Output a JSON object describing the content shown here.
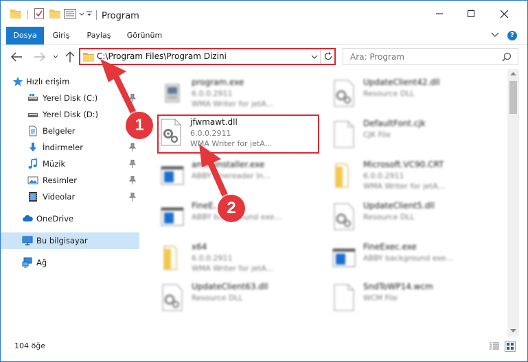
{
  "window": {
    "title": "Program"
  },
  "ribbon": {
    "tabs": [
      "Dosya",
      "Giriş",
      "Paylaş",
      "Görünüm"
    ],
    "help": "?"
  },
  "address": {
    "path": "C:\\Program Files\\Program Dizini"
  },
  "search": {
    "placeholder": "Ara: Program"
  },
  "sidebar": {
    "items": [
      {
        "label": "Hızlı erişim",
        "icon": "star-icon",
        "pinned": false
      },
      {
        "label": "Yerel Disk (C:)",
        "icon": "drive-icon",
        "pinned": true
      },
      {
        "label": "Yerel Disk (D:)",
        "icon": "drive-icon",
        "pinned": true
      },
      {
        "label": "Belgeler",
        "icon": "document-icon",
        "pinned": true
      },
      {
        "label": "İndirmeler",
        "icon": "download-icon",
        "pinned": true
      },
      {
        "label": "Müzik",
        "icon": "music-icon",
        "pinned": true
      },
      {
        "label": "Resimler",
        "icon": "pictures-icon",
        "pinned": true
      },
      {
        "label": "Videolar",
        "icon": "videos-icon",
        "pinned": true
      },
      {
        "label": "OneDrive",
        "icon": "cloud-icon",
        "pinned": false
      },
      {
        "label": "Bu bilgisayar",
        "icon": "computer-icon",
        "pinned": false,
        "selected": true
      },
      {
        "label": "Ağ",
        "icon": "network-icon",
        "pinned": false
      }
    ]
  },
  "files": {
    "left": [
      {
        "name": "program.exe",
        "line1": "6.0.0.2911",
        "line2": "WMA Writer for jetA...",
        "icon": "exe-icon"
      },
      {
        "name": "jfwmawt.dll",
        "line1": "6.0.0.2911",
        "line2": "WMA Writer for jetA...",
        "icon": "dll-icon"
      },
      {
        "name": "ammiinstaller.exe",
        "line1": "ABBY Finereader In...",
        "line2": "",
        "icon": "window-icon"
      },
      {
        "name": "FineE...e",
        "line1": "ABBY background exe...",
        "line2": "",
        "icon": "window-icon"
      },
      {
        "name": "x64",
        "line1": "6.0.0.2911",
        "line2": "WMA Writer for jetA...",
        "icon": "folder-icon"
      },
      {
        "name": "UpdateClient63.dll",
        "line1": "Resource DLL",
        "line2": "",
        "icon": "dll-icon"
      }
    ],
    "right": [
      {
        "name": "UpdateClient42.dll",
        "line1": "Resource DLL",
        "line2": "",
        "icon": "dll-icon"
      },
      {
        "name": "DefaultFont.cjk",
        "line1": "CJK File",
        "line2": "",
        "icon": "blank-file-icon"
      },
      {
        "name": "Microsoft.VC90.CRT",
        "line1": "6.0.0.2911",
        "line2": "WMA Writer for jetA...",
        "icon": "folder-icon"
      },
      {
        "name": "UpdateClient5.dll",
        "line1": "Resource DLL",
        "line2": "",
        "icon": "dll-icon"
      },
      {
        "name": "FineExec.exe",
        "line1": "ABBY background exe...",
        "line2": "",
        "icon": "window-icon"
      },
      {
        "name": "SndToWP14.wcm",
        "line1": "WCM File",
        "line2": "",
        "icon": "blank-file-icon"
      }
    ]
  },
  "status": {
    "count": "104 öğe"
  },
  "annotations": {
    "step1": "1",
    "step2": "2",
    "color": "#e3373c"
  },
  "colors": {
    "accent": "#1979ca",
    "highlight": "#e0262f",
    "selected": "#cce4f7"
  }
}
